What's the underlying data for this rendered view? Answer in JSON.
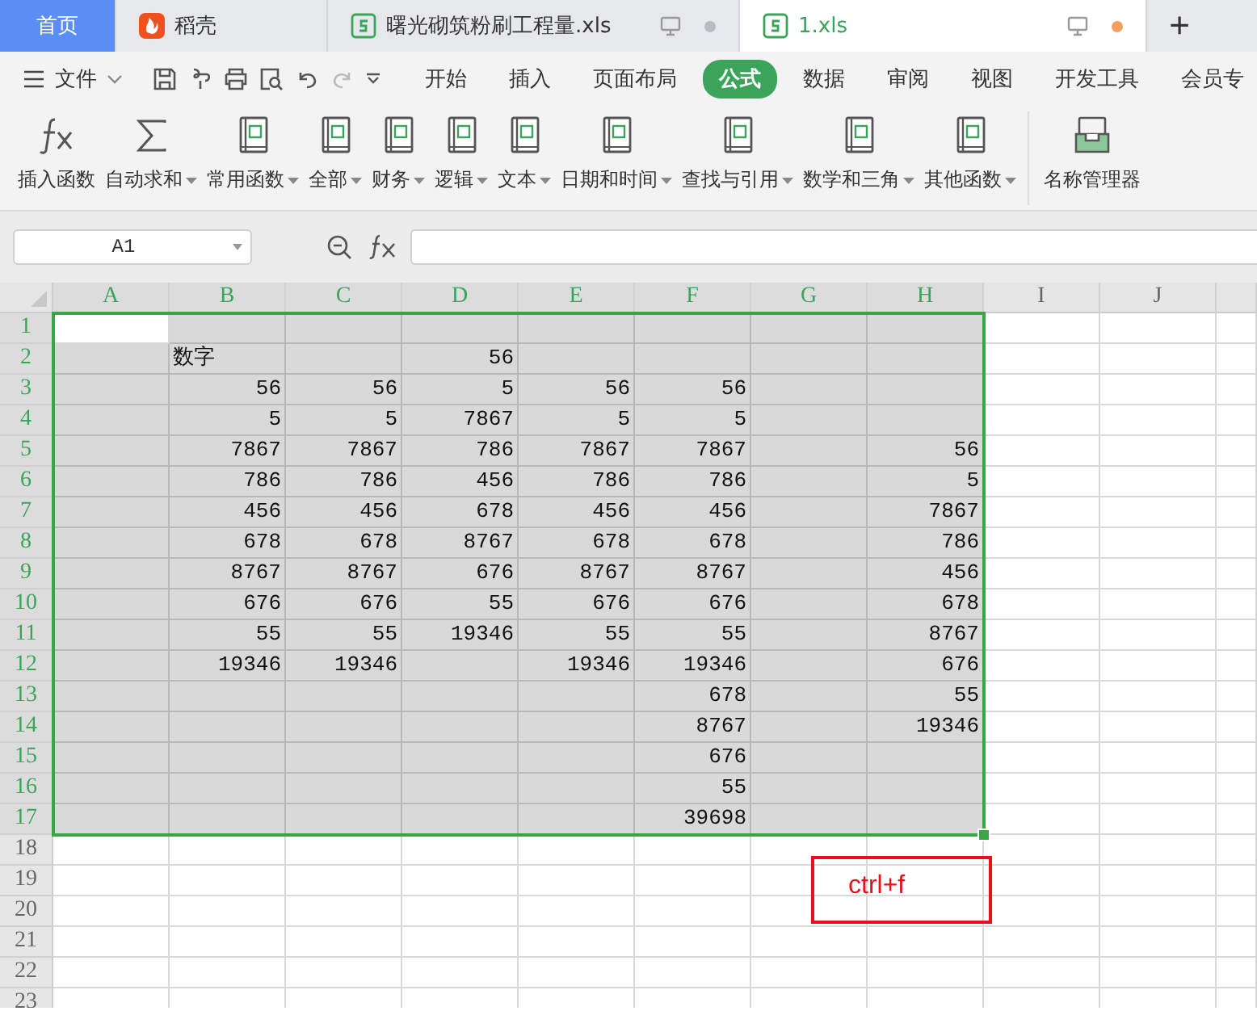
{
  "tabs": [
    {
      "label": "首页",
      "kind": "home",
      "selected": false
    },
    {
      "label": "稻壳",
      "kind": "docer",
      "selected": false
    },
    {
      "label": "曙光砌筑粉刷工程量.xls",
      "kind": "sheet",
      "selected": false,
      "modified": false
    },
    {
      "label": "1.xls",
      "kind": "sheet",
      "selected": true,
      "modified": true
    }
  ],
  "new_tab": "+",
  "file_menu": "文件",
  "menu_tabs": [
    {
      "label": "开始",
      "selected": false
    },
    {
      "label": "插入",
      "selected": false
    },
    {
      "label": "页面布局",
      "selected": false
    },
    {
      "label": "公式",
      "selected": true
    },
    {
      "label": "数据",
      "selected": false
    },
    {
      "label": "审阅",
      "selected": false
    },
    {
      "label": "视图",
      "selected": false
    },
    {
      "label": "开发工具",
      "selected": false
    },
    {
      "label": "会员专",
      "selected": false
    }
  ],
  "ribbon": [
    {
      "label": "插入函数",
      "dropdown": false
    },
    {
      "label": "自动求和",
      "dropdown": true
    },
    {
      "label": "常用函数",
      "dropdown": true
    },
    {
      "label": "全部",
      "dropdown": true
    },
    {
      "label": "财务",
      "dropdown": true
    },
    {
      "label": "逻辑",
      "dropdown": true
    },
    {
      "label": "文本",
      "dropdown": true
    },
    {
      "label": "日期和时间",
      "dropdown": true
    },
    {
      "label": "查找与引用",
      "dropdown": true
    },
    {
      "label": "数学和三角",
      "dropdown": true
    },
    {
      "label": "其他函数",
      "dropdown": true
    },
    {
      "label": "名称管理器",
      "dropdown": false
    }
  ],
  "name_box": "A1",
  "columns": [
    {
      "label": "A",
      "selected": true
    },
    {
      "label": "B",
      "selected": true
    },
    {
      "label": "C",
      "selected": true
    },
    {
      "label": "D",
      "selected": true
    },
    {
      "label": "E",
      "selected": true
    },
    {
      "label": "F",
      "selected": true
    },
    {
      "label": "G",
      "selected": true
    },
    {
      "label": "H",
      "selected": true
    },
    {
      "label": "I",
      "selected": false
    },
    {
      "label": "J",
      "selected": false
    }
  ],
  "rows": [
    {
      "label": "1",
      "selected": true,
      "cells": [
        {
          "active": true
        },
        null,
        null,
        null,
        null,
        null,
        null,
        null
      ]
    },
    {
      "label": "2",
      "selected": true,
      "cells": [
        null,
        {
          "text": "数字",
          "kind": "text"
        },
        null,
        {
          "text": "56"
        },
        null,
        null,
        null,
        null
      ]
    },
    {
      "label": "3",
      "selected": true,
      "cells": [
        null,
        {
          "text": "56"
        },
        {
          "text": "56"
        },
        {
          "text": "5"
        },
        {
          "text": "56"
        },
        {
          "text": "56"
        },
        null,
        null
      ]
    },
    {
      "label": "4",
      "selected": true,
      "cells": [
        null,
        {
          "text": "5"
        },
        {
          "text": "5"
        },
        {
          "text": "7867"
        },
        {
          "text": "5"
        },
        {
          "text": "5"
        },
        null,
        null
      ]
    },
    {
      "label": "5",
      "selected": true,
      "cells": [
        null,
        {
          "text": "7867"
        },
        {
          "text": "7867"
        },
        {
          "text": "786"
        },
        {
          "text": "7867"
        },
        {
          "text": "7867"
        },
        null,
        {
          "text": "56"
        }
      ]
    },
    {
      "label": "6",
      "selected": true,
      "cells": [
        null,
        {
          "text": "786"
        },
        {
          "text": "786"
        },
        {
          "text": "456"
        },
        {
          "text": "786"
        },
        {
          "text": "786"
        },
        null,
        {
          "text": "5"
        }
      ]
    },
    {
      "label": "7",
      "selected": true,
      "cells": [
        null,
        {
          "text": "456"
        },
        {
          "text": "456"
        },
        {
          "text": "678"
        },
        {
          "text": "456"
        },
        {
          "text": "456"
        },
        null,
        {
          "text": "7867"
        }
      ]
    },
    {
      "label": "8",
      "selected": true,
      "cells": [
        null,
        {
          "text": "678"
        },
        {
          "text": "678"
        },
        {
          "text": "8767"
        },
        {
          "text": "678"
        },
        {
          "text": "678"
        },
        null,
        {
          "text": "786"
        }
      ]
    },
    {
      "label": "9",
      "selected": true,
      "cells": [
        null,
        {
          "text": "8767"
        },
        {
          "text": "8767"
        },
        {
          "text": "676"
        },
        {
          "text": "8767"
        },
        {
          "text": "8767"
        },
        null,
        {
          "text": "456"
        }
      ]
    },
    {
      "label": "10",
      "selected": true,
      "cells": [
        null,
        {
          "text": "676"
        },
        {
          "text": "676"
        },
        {
          "text": "55"
        },
        {
          "text": "676"
        },
        {
          "text": "676"
        },
        null,
        {
          "text": "678"
        }
      ]
    },
    {
      "label": "11",
      "selected": true,
      "cells": [
        null,
        {
          "text": "55"
        },
        {
          "text": "55"
        },
        {
          "text": "19346"
        },
        {
          "text": "55"
        },
        {
          "text": "55"
        },
        null,
        {
          "text": "8767"
        }
      ]
    },
    {
      "label": "12",
      "selected": true,
      "cells": [
        null,
        {
          "text": "19346"
        },
        {
          "text": "19346"
        },
        null,
        {
          "text": "19346"
        },
        {
          "text": "19346"
        },
        null,
        {
          "text": "676"
        }
      ]
    },
    {
      "label": "13",
      "selected": true,
      "cells": [
        null,
        null,
        null,
        null,
        null,
        {
          "text": "678"
        },
        null,
        {
          "text": "55"
        }
      ]
    },
    {
      "label": "14",
      "selected": true,
      "cells": [
        null,
        null,
        null,
        null,
        null,
        {
          "text": "8767"
        },
        null,
        {
          "text": "19346"
        }
      ]
    },
    {
      "label": "15",
      "selected": true,
      "cells": [
        null,
        null,
        null,
        null,
        null,
        {
          "text": "676"
        },
        null,
        null
      ]
    },
    {
      "label": "16",
      "selected": true,
      "cells": [
        null,
        null,
        null,
        null,
        null,
        {
          "text": "55"
        },
        null,
        null
      ]
    },
    {
      "label": "17",
      "selected": true,
      "cells": [
        null,
        null,
        null,
        null,
        null,
        {
          "text": "39698"
        },
        null,
        null
      ]
    },
    {
      "label": "18",
      "selected": false
    },
    {
      "label": "19",
      "selected": false
    },
    {
      "label": "20",
      "selected": false
    },
    {
      "label": "21",
      "selected": false
    },
    {
      "label": "22",
      "selected": false
    },
    {
      "label": "23",
      "selected": false
    }
  ],
  "annotation": "ctrl+f"
}
